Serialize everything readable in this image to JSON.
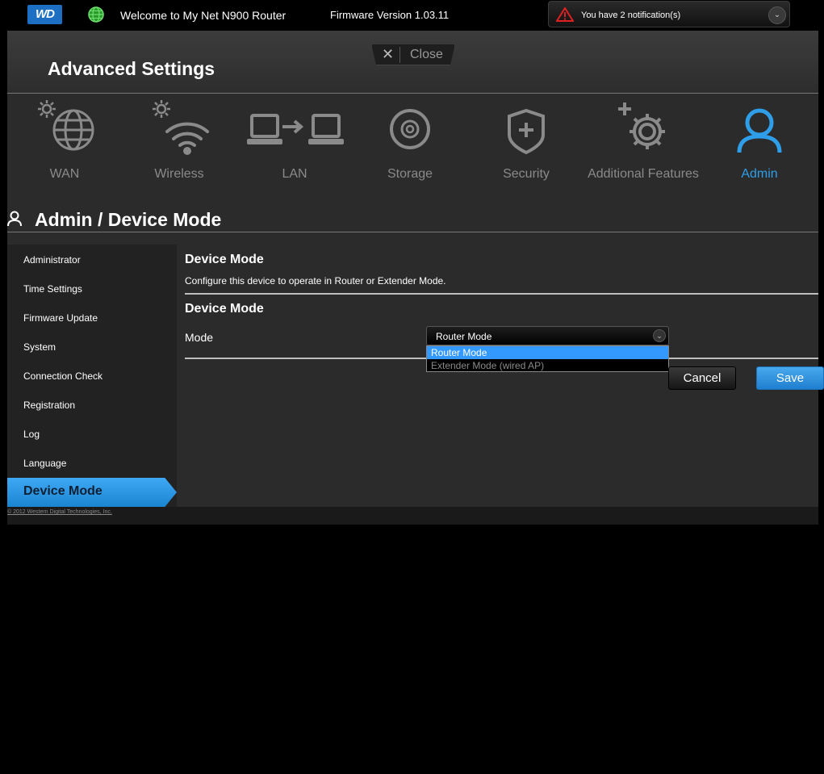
{
  "topbar": {
    "logo": "WD",
    "welcome": "Welcome to My Net N900 Router",
    "firmware": "Firmware Version 1.03.11",
    "notification": "You have 2 notification(s)"
  },
  "panel": {
    "title": "Advanced Settings",
    "close_label": "Close"
  },
  "nav": {
    "items": [
      {
        "label": "WAN",
        "icon": "globe-icon"
      },
      {
        "label": "Wireless",
        "icon": "wifi-icon"
      },
      {
        "label": "LAN",
        "icon": "lan-icon"
      },
      {
        "label": "Storage",
        "icon": "disc-icon"
      },
      {
        "label": "Security",
        "icon": "shield-icon"
      },
      {
        "label": "Additional Features",
        "icon": "gears-icon"
      },
      {
        "label": "Admin",
        "icon": "person-icon"
      }
    ],
    "active": "Admin"
  },
  "page": {
    "title": "Admin / Device Mode"
  },
  "sidebar": {
    "items": [
      "Administrator",
      "Time Settings",
      "Firmware Update",
      "System",
      "Connection Check",
      "Registration",
      "Log",
      "Language",
      "Device Mode"
    ]
  },
  "content": {
    "heading1": "Device Mode",
    "description": "Configure this device to operate in Router or Extender Mode.",
    "heading2": "Device Mode",
    "mode_label": "Mode",
    "mode_value": "Router Mode",
    "options": [
      "Router Mode",
      "Extender Mode (wired AP)"
    ]
  },
  "buttons": {
    "cancel": "Cancel",
    "save": "Save"
  },
  "footer": {
    "copyright": "© 2012 Western Digital Technologies, Inc."
  },
  "colors": {
    "accent": "#2f9ee8",
    "panel": "#2b2b2b"
  }
}
